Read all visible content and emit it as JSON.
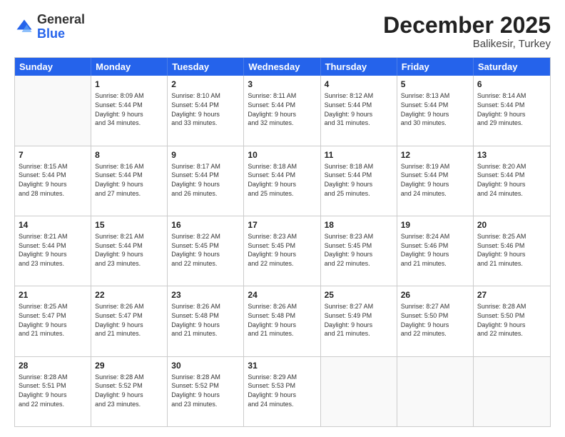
{
  "logo": {
    "general": "General",
    "blue": "Blue"
  },
  "title": "December 2025",
  "subtitle": "Balikesir, Turkey",
  "header_days": [
    "Sunday",
    "Monday",
    "Tuesday",
    "Wednesday",
    "Thursday",
    "Friday",
    "Saturday"
  ],
  "rows": [
    [
      {
        "day": "",
        "lines": []
      },
      {
        "day": "1",
        "lines": [
          "Sunrise: 8:09 AM",
          "Sunset: 5:44 PM",
          "Daylight: 9 hours",
          "and 34 minutes."
        ]
      },
      {
        "day": "2",
        "lines": [
          "Sunrise: 8:10 AM",
          "Sunset: 5:44 PM",
          "Daylight: 9 hours",
          "and 33 minutes."
        ]
      },
      {
        "day": "3",
        "lines": [
          "Sunrise: 8:11 AM",
          "Sunset: 5:44 PM",
          "Daylight: 9 hours",
          "and 32 minutes."
        ]
      },
      {
        "day": "4",
        "lines": [
          "Sunrise: 8:12 AM",
          "Sunset: 5:44 PM",
          "Daylight: 9 hours",
          "and 31 minutes."
        ]
      },
      {
        "day": "5",
        "lines": [
          "Sunrise: 8:13 AM",
          "Sunset: 5:44 PM",
          "Daylight: 9 hours",
          "and 30 minutes."
        ]
      },
      {
        "day": "6",
        "lines": [
          "Sunrise: 8:14 AM",
          "Sunset: 5:44 PM",
          "Daylight: 9 hours",
          "and 29 minutes."
        ]
      }
    ],
    [
      {
        "day": "7",
        "lines": [
          "Sunrise: 8:15 AM",
          "Sunset: 5:44 PM",
          "Daylight: 9 hours",
          "and 28 minutes."
        ]
      },
      {
        "day": "8",
        "lines": [
          "Sunrise: 8:16 AM",
          "Sunset: 5:44 PM",
          "Daylight: 9 hours",
          "and 27 minutes."
        ]
      },
      {
        "day": "9",
        "lines": [
          "Sunrise: 8:17 AM",
          "Sunset: 5:44 PM",
          "Daylight: 9 hours",
          "and 26 minutes."
        ]
      },
      {
        "day": "10",
        "lines": [
          "Sunrise: 8:18 AM",
          "Sunset: 5:44 PM",
          "Daylight: 9 hours",
          "and 25 minutes."
        ]
      },
      {
        "day": "11",
        "lines": [
          "Sunrise: 8:18 AM",
          "Sunset: 5:44 PM",
          "Daylight: 9 hours",
          "and 25 minutes."
        ]
      },
      {
        "day": "12",
        "lines": [
          "Sunrise: 8:19 AM",
          "Sunset: 5:44 PM",
          "Daylight: 9 hours",
          "and 24 minutes."
        ]
      },
      {
        "day": "13",
        "lines": [
          "Sunrise: 8:20 AM",
          "Sunset: 5:44 PM",
          "Daylight: 9 hours",
          "and 24 minutes."
        ]
      }
    ],
    [
      {
        "day": "14",
        "lines": [
          "Sunrise: 8:21 AM",
          "Sunset: 5:44 PM",
          "Daylight: 9 hours",
          "and 23 minutes."
        ]
      },
      {
        "day": "15",
        "lines": [
          "Sunrise: 8:21 AM",
          "Sunset: 5:44 PM",
          "Daylight: 9 hours",
          "and 23 minutes."
        ]
      },
      {
        "day": "16",
        "lines": [
          "Sunrise: 8:22 AM",
          "Sunset: 5:45 PM",
          "Daylight: 9 hours",
          "and 22 minutes."
        ]
      },
      {
        "day": "17",
        "lines": [
          "Sunrise: 8:23 AM",
          "Sunset: 5:45 PM",
          "Daylight: 9 hours",
          "and 22 minutes."
        ]
      },
      {
        "day": "18",
        "lines": [
          "Sunrise: 8:23 AM",
          "Sunset: 5:45 PM",
          "Daylight: 9 hours",
          "and 22 minutes."
        ]
      },
      {
        "day": "19",
        "lines": [
          "Sunrise: 8:24 AM",
          "Sunset: 5:46 PM",
          "Daylight: 9 hours",
          "and 21 minutes."
        ]
      },
      {
        "day": "20",
        "lines": [
          "Sunrise: 8:25 AM",
          "Sunset: 5:46 PM",
          "Daylight: 9 hours",
          "and 21 minutes."
        ]
      }
    ],
    [
      {
        "day": "21",
        "lines": [
          "Sunrise: 8:25 AM",
          "Sunset: 5:47 PM",
          "Daylight: 9 hours",
          "and 21 minutes."
        ]
      },
      {
        "day": "22",
        "lines": [
          "Sunrise: 8:26 AM",
          "Sunset: 5:47 PM",
          "Daylight: 9 hours",
          "and 21 minutes."
        ]
      },
      {
        "day": "23",
        "lines": [
          "Sunrise: 8:26 AM",
          "Sunset: 5:48 PM",
          "Daylight: 9 hours",
          "and 21 minutes."
        ]
      },
      {
        "day": "24",
        "lines": [
          "Sunrise: 8:26 AM",
          "Sunset: 5:48 PM",
          "Daylight: 9 hours",
          "and 21 minutes."
        ]
      },
      {
        "day": "25",
        "lines": [
          "Sunrise: 8:27 AM",
          "Sunset: 5:49 PM",
          "Daylight: 9 hours",
          "and 21 minutes."
        ]
      },
      {
        "day": "26",
        "lines": [
          "Sunrise: 8:27 AM",
          "Sunset: 5:50 PM",
          "Daylight: 9 hours",
          "and 22 minutes."
        ]
      },
      {
        "day": "27",
        "lines": [
          "Sunrise: 8:28 AM",
          "Sunset: 5:50 PM",
          "Daylight: 9 hours",
          "and 22 minutes."
        ]
      }
    ],
    [
      {
        "day": "28",
        "lines": [
          "Sunrise: 8:28 AM",
          "Sunset: 5:51 PM",
          "Daylight: 9 hours",
          "and 22 minutes."
        ]
      },
      {
        "day": "29",
        "lines": [
          "Sunrise: 8:28 AM",
          "Sunset: 5:52 PM",
          "Daylight: 9 hours",
          "and 23 minutes."
        ]
      },
      {
        "day": "30",
        "lines": [
          "Sunrise: 8:28 AM",
          "Sunset: 5:52 PM",
          "Daylight: 9 hours",
          "and 23 minutes."
        ]
      },
      {
        "day": "31",
        "lines": [
          "Sunrise: 8:29 AM",
          "Sunset: 5:53 PM",
          "Daylight: 9 hours",
          "and 24 minutes."
        ]
      },
      {
        "day": "",
        "lines": []
      },
      {
        "day": "",
        "lines": []
      },
      {
        "day": "",
        "lines": []
      }
    ]
  ]
}
